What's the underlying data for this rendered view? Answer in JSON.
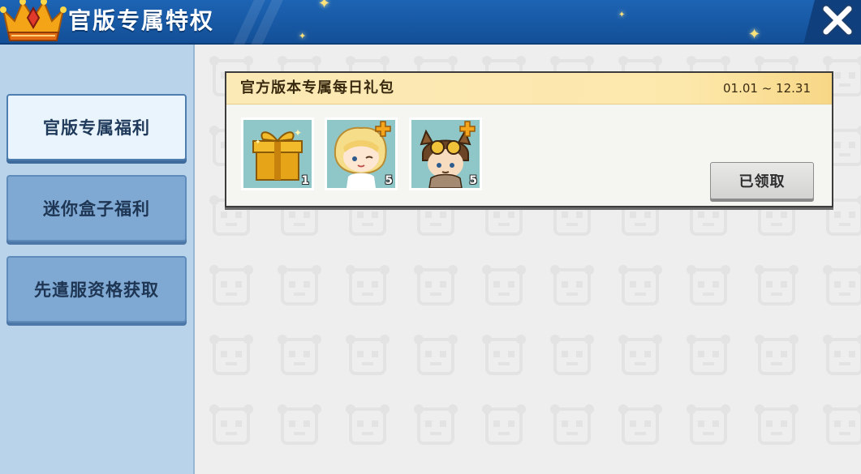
{
  "header": {
    "title": "官版专属特权",
    "close_icon": "close-x-icon",
    "accent_color": "#1d64b4"
  },
  "sidebar": {
    "items": [
      {
        "label": "官版专属福利",
        "active": true
      },
      {
        "label": "迷你盒子福利",
        "active": false
      },
      {
        "label": "先遣服资格获取",
        "active": false
      }
    ]
  },
  "gift": {
    "title": "官方版本专属每日礼包",
    "date_range": "01.01 ~ 12.31",
    "rewards": [
      {
        "icon": "gift-box-icon",
        "count": "1"
      },
      {
        "icon": "blonde-character-skin-icon",
        "count": "5"
      },
      {
        "icon": "aviator-character-skin-icon",
        "count": "5"
      }
    ],
    "claim_button": "已领取",
    "claimed": true
  }
}
